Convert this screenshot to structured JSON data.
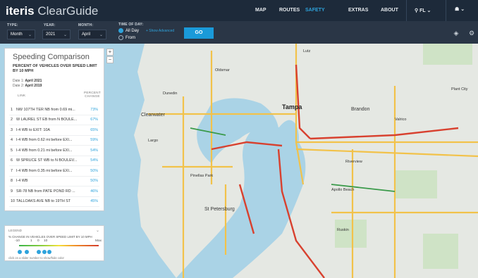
{
  "app": {
    "brand_bold": "iteris",
    "brand_light": "ClearGuide"
  },
  "nav": [
    {
      "label": "MAP",
      "active": false
    },
    {
      "label": "ROUTES",
      "active": false
    },
    {
      "label": "SAFETY",
      "active": true
    },
    {
      "label": "EXTRAS",
      "active": false
    },
    {
      "label": "ABOUT",
      "active": false
    }
  ],
  "region": {
    "label": "FL"
  },
  "controls": {
    "type_label": "TYPE:",
    "type_value": "Month",
    "year_label": "YEAR:",
    "year_value": "2021",
    "month_label": "MONTH:",
    "month_value": "April",
    "time_label": "TIME OF DAY:",
    "all_day": "All Day",
    "from": "From",
    "show_advanced": "+ Show Advanced",
    "go": "GO"
  },
  "panel": {
    "title": "Speeding Comparison",
    "subtitle": "PERCENT OF VEHICLES OVER SPEED LIMIT BY 10 MPH",
    "date1_label": "Date 1:",
    "date1_value": "April 2021",
    "date2_label": "Date 2:",
    "date2_value": "April 2019",
    "col_link": "LINK",
    "col_pct": "PERCENT CHANGE",
    "rows": [
      {
        "n": "1",
        "link": "NW 107TH TER NB from 0.69 mi...",
        "pct": "73%"
      },
      {
        "n": "2",
        "link": "W LAUREL ST EB from N BOULE...",
        "pct": "67%"
      },
      {
        "n": "3",
        "link": "I-4 WB to EXIT: 10A",
        "pct": "65%"
      },
      {
        "n": "4",
        "link": "I-4 WB from 0.62 mi before EXI...",
        "pct": "59%"
      },
      {
        "n": "5",
        "link": "I-4 WB from 0.21 mi before EXI...",
        "pct": "54%"
      },
      {
        "n": "6",
        "link": "W SPRUCE ST WB to N BOULEV...",
        "pct": "54%"
      },
      {
        "n": "7",
        "link": "I-4 WB from 0.35 mi before EXI...",
        "pct": "50%"
      },
      {
        "n": "8",
        "link": "I-4 WB",
        "pct": "50%"
      },
      {
        "n": "9",
        "link": "SR-78 NB from PATE POND RD ...",
        "pct": "46%"
      },
      {
        "n": "10",
        "link": "TALLOAKS AVE NB to 19TH ST",
        "pct": "45%"
      }
    ]
  },
  "legend": {
    "title": "LEGEND",
    "subtitle": "% CHANGE IN VEHICLES OVER SPEED LIMIT BY 10 MPH",
    "nums": [
      "-10",
      "1",
      "0",
      "10",
      "Max"
    ],
    "hint": "click on a slider number to show/hide color"
  },
  "map_labels": {
    "tampa": "Tampa",
    "clearwater": "Clearwater",
    "st_petersburg": "St Petersburg",
    "brandon": "Brandon",
    "pinellas_park": "Pinellas Park",
    "largo": "Largo",
    "dunedin": "Dunedin",
    "oldsmar": "Oldsmar",
    "plant_city": "Plant City",
    "riverview": "Riverview",
    "valrico": "Valrico",
    "apollo_beach": "Apollo Beach",
    "ruskin": "Ruskin",
    "lutz": "Lutz"
  }
}
